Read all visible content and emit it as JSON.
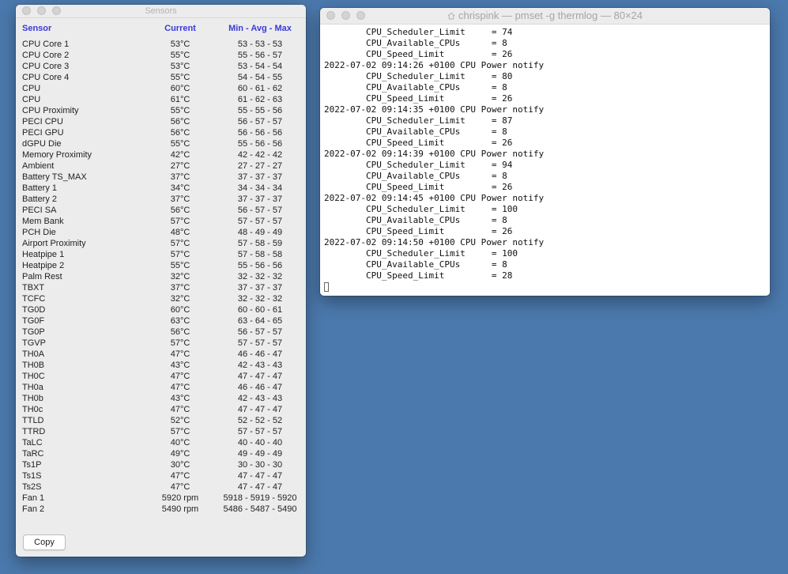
{
  "sensors_window": {
    "title": "Sensors",
    "headers": {
      "sensor": "Sensor",
      "current": "Current",
      "min_avg_max": "Min - Avg - Max"
    },
    "rows": [
      {
        "name": "CPU Core 1",
        "current": "53°C",
        "mam": "53 - 53 - 53"
      },
      {
        "name": "CPU Core 2",
        "current": "55°C",
        "mam": "55 - 56 - 57"
      },
      {
        "name": "CPU Core 3",
        "current": "53°C",
        "mam": "53 - 54 - 54"
      },
      {
        "name": "CPU Core 4",
        "current": "55°C",
        "mam": "54 - 54 - 55"
      },
      {
        "name": "CPU",
        "current": "60°C",
        "mam": "60 - 61 - 62"
      },
      {
        "name": "CPU",
        "current": "61°C",
        "mam": "61 - 62 - 63"
      },
      {
        "name": "CPU Proximity",
        "current": "55°C",
        "mam": "55 - 55 - 56"
      },
      {
        "name": "PECI CPU",
        "current": "56°C",
        "mam": "56 - 57 - 57"
      },
      {
        "name": "PECI GPU",
        "current": "56°C",
        "mam": "56 - 56 - 56"
      },
      {
        "name": "dGPU Die",
        "current": "55°C",
        "mam": "55 - 56 - 56"
      },
      {
        "name": "Memory Proximity",
        "current": "42°C",
        "mam": "42 - 42 - 42"
      },
      {
        "name": "Ambient",
        "current": "27°C",
        "mam": "27 - 27 - 27"
      },
      {
        "name": "Battery TS_MAX",
        "current": "37°C",
        "mam": "37 - 37 - 37"
      },
      {
        "name": "Battery 1",
        "current": "34°C",
        "mam": "34 - 34 - 34"
      },
      {
        "name": "Battery 2",
        "current": "37°C",
        "mam": "37 - 37 - 37"
      },
      {
        "name": "PECI SA",
        "current": "56°C",
        "mam": "56 - 57 - 57"
      },
      {
        "name": "Mem Bank",
        "current": "57°C",
        "mam": "57 - 57 - 57"
      },
      {
        "name": "PCH Die",
        "current": "48°C",
        "mam": "48 - 49 - 49"
      },
      {
        "name": "Airport Proximity",
        "current": "57°C",
        "mam": "57 - 58 - 59"
      },
      {
        "name": "Heatpipe 1",
        "current": "57°C",
        "mam": "57 - 58 - 58"
      },
      {
        "name": "Heatpipe 2",
        "current": "55°C",
        "mam": "55 - 56 - 56"
      },
      {
        "name": "Palm Rest",
        "current": "32°C",
        "mam": "32 - 32 - 32"
      },
      {
        "name": "TBXT",
        "current": "37°C",
        "mam": "37 - 37 - 37"
      },
      {
        "name": "TCFC",
        "current": "32°C",
        "mam": "32 - 32 - 32"
      },
      {
        "name": "TG0D",
        "current": "60°C",
        "mam": "60 - 60 - 61"
      },
      {
        "name": "TG0F",
        "current": "63°C",
        "mam": "63 - 64 - 65"
      },
      {
        "name": "TG0P",
        "current": "56°C",
        "mam": "56 - 57 - 57"
      },
      {
        "name": "TGVP",
        "current": "57°C",
        "mam": "57 - 57 - 57"
      },
      {
        "name": "TH0A",
        "current": "47°C",
        "mam": "46 - 46 - 47"
      },
      {
        "name": "TH0B",
        "current": "43°C",
        "mam": "42 - 43 - 43"
      },
      {
        "name": "TH0C",
        "current": "47°C",
        "mam": "47 - 47 - 47"
      },
      {
        "name": "TH0a",
        "current": "47°C",
        "mam": "46 - 46 - 47"
      },
      {
        "name": "TH0b",
        "current": "43°C",
        "mam": "42 - 43 - 43"
      },
      {
        "name": "TH0c",
        "current": "47°C",
        "mam": "47 - 47 - 47"
      },
      {
        "name": "TTLD",
        "current": "52°C",
        "mam": "52 - 52 - 52"
      },
      {
        "name": "TTRD",
        "current": "57°C",
        "mam": "57 - 57 - 57"
      },
      {
        "name": "TaLC",
        "current": "40°C",
        "mam": "40 - 40 - 40"
      },
      {
        "name": "TaRC",
        "current": "49°C",
        "mam": "49 - 49 - 49"
      },
      {
        "name": "Ts1P",
        "current": "30°C",
        "mam": "30 - 30 - 30"
      },
      {
        "name": "Ts1S",
        "current": "47°C",
        "mam": "47 - 47 - 47"
      },
      {
        "name": "Ts2S",
        "current": "47°C",
        "mam": "47 - 47 - 47"
      },
      {
        "name": "Fan 1",
        "current": "5920 rpm",
        "mam": "5918 - 5919 - 5920"
      },
      {
        "name": "Fan 2",
        "current": "5490 rpm",
        "mam": "5486 - 5487 - 5490"
      }
    ],
    "copy_label": "Copy"
  },
  "terminal_window": {
    "title": "chrispink — pmset -g thermlog — 80×24",
    "lines": [
      "        CPU_Scheduler_Limit     = 74",
      "        CPU_Available_CPUs      = 8",
      "        CPU_Speed_Limit         = 26",
      "2022-07-02 09:14:26 +0100 CPU Power notify",
      "        CPU_Scheduler_Limit     = 80",
      "        CPU_Available_CPUs      = 8",
      "        CPU_Speed_Limit         = 26",
      "2022-07-02 09:14:35 +0100 CPU Power notify",
      "        CPU_Scheduler_Limit     = 87",
      "        CPU_Available_CPUs      = 8",
      "        CPU_Speed_Limit         = 26",
      "2022-07-02 09:14:39 +0100 CPU Power notify",
      "        CPU_Scheduler_Limit     = 94",
      "        CPU_Available_CPUs      = 8",
      "        CPU_Speed_Limit         = 26",
      "2022-07-02 09:14:45 +0100 CPU Power notify",
      "        CPU_Scheduler_Limit     = 100",
      "        CPU_Available_CPUs      = 8",
      "        CPU_Speed_Limit         = 26",
      "2022-07-02 09:14:50 +0100 CPU Power notify",
      "        CPU_Scheduler_Limit     = 100",
      "        CPU_Available_CPUs      = 8",
      "        CPU_Speed_Limit         = 28"
    ]
  },
  "colors": {
    "desktop": "#4b79ad",
    "header_accent": "#3a3ad8"
  }
}
